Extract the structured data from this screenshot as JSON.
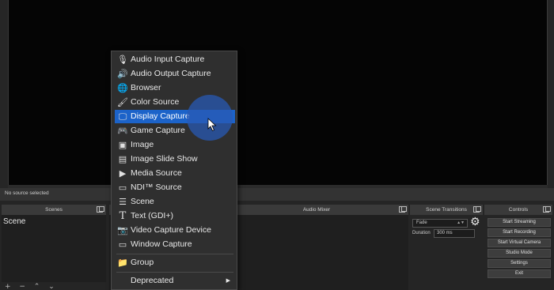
{
  "status": {
    "no_source": "No source selected"
  },
  "scenes": {
    "header": "Scenes",
    "items": [
      "Scene"
    ],
    "tools": "+ − ⌃ ⌄"
  },
  "mixer": {
    "header": "Audio Mixer"
  },
  "transitions": {
    "header": "Scene Transitions",
    "type": "Fade",
    "duration_label": "Duration",
    "duration_value": "300 ms"
  },
  "controls": {
    "header": "Controls",
    "buttons": [
      "Start Streaming",
      "Start Recording",
      "Start Virtual Camera",
      "Studio Mode",
      "Settings",
      "Exit"
    ]
  },
  "menu": {
    "items": [
      {
        "label": "Audio Input Capture",
        "icon": "microphone-icon",
        "glyph": "🎙"
      },
      {
        "label": "Audio Output Capture",
        "icon": "speaker-icon",
        "glyph": "🔊"
      },
      {
        "label": "Browser",
        "icon": "globe-icon",
        "glyph": "🌐"
      },
      {
        "label": "Color Source",
        "icon": "brush-icon",
        "glyph": "🖌"
      },
      {
        "label": "Display Capture",
        "icon": "monitor-icon",
        "glyph": "🖵"
      },
      {
        "label": "Game Capture",
        "icon": "gamepad-icon",
        "glyph": "🎮"
      },
      {
        "label": "Image",
        "icon": "image-icon",
        "glyph": "▣"
      },
      {
        "label": "Image Slide Show",
        "icon": "slideshow-icon",
        "glyph": "▤"
      },
      {
        "label": "Media Source",
        "icon": "play-icon",
        "glyph": "▶"
      },
      {
        "label": "NDI™ Source",
        "icon": "ndi-icon",
        "glyph": "▭"
      },
      {
        "label": "Scene",
        "icon": "list-icon",
        "glyph": "☰"
      },
      {
        "label": "Text (GDI+)",
        "icon": "text-icon",
        "glyph": "T"
      },
      {
        "label": "Video Capture Device",
        "icon": "camera-icon",
        "glyph": "📷"
      },
      {
        "label": "Window Capture",
        "icon": "window-icon",
        "glyph": "▭"
      },
      {
        "label": "Group",
        "icon": "folder-icon",
        "glyph": "📁"
      },
      {
        "label": "Deprecated",
        "icon": "",
        "glyph": ""
      }
    ],
    "highlighted": "Display Capture",
    "submenu_arrow": "▶"
  },
  "colors": {
    "highlight": "#1c63c9",
    "menu_bg": "#2f2f2f",
    "preview_bg": "#050505"
  }
}
